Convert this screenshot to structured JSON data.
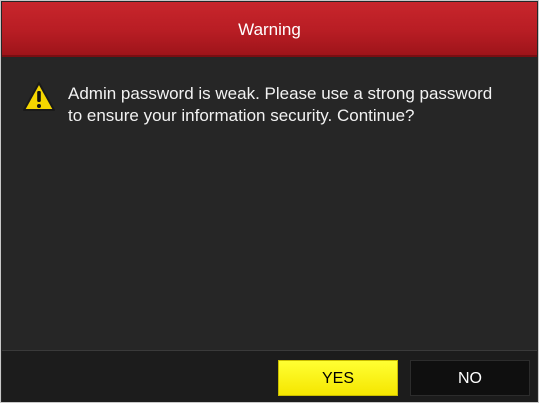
{
  "dialog": {
    "title": "Warning",
    "message_line1": "Admin password is weak. Please use a strong password",
    "message_line2": "to ensure your information security. Continue?",
    "icon": "warning-triangle-icon",
    "buttons": {
      "yes_label": "YES",
      "no_label": "NO"
    }
  },
  "colors": {
    "title_bar": "#b81d24",
    "body_background": "#262626",
    "footer_background": "#1c1c1c",
    "yes_button": "#f5e600",
    "no_button": "#0f0f0f",
    "warning_icon": "#f5d600"
  }
}
